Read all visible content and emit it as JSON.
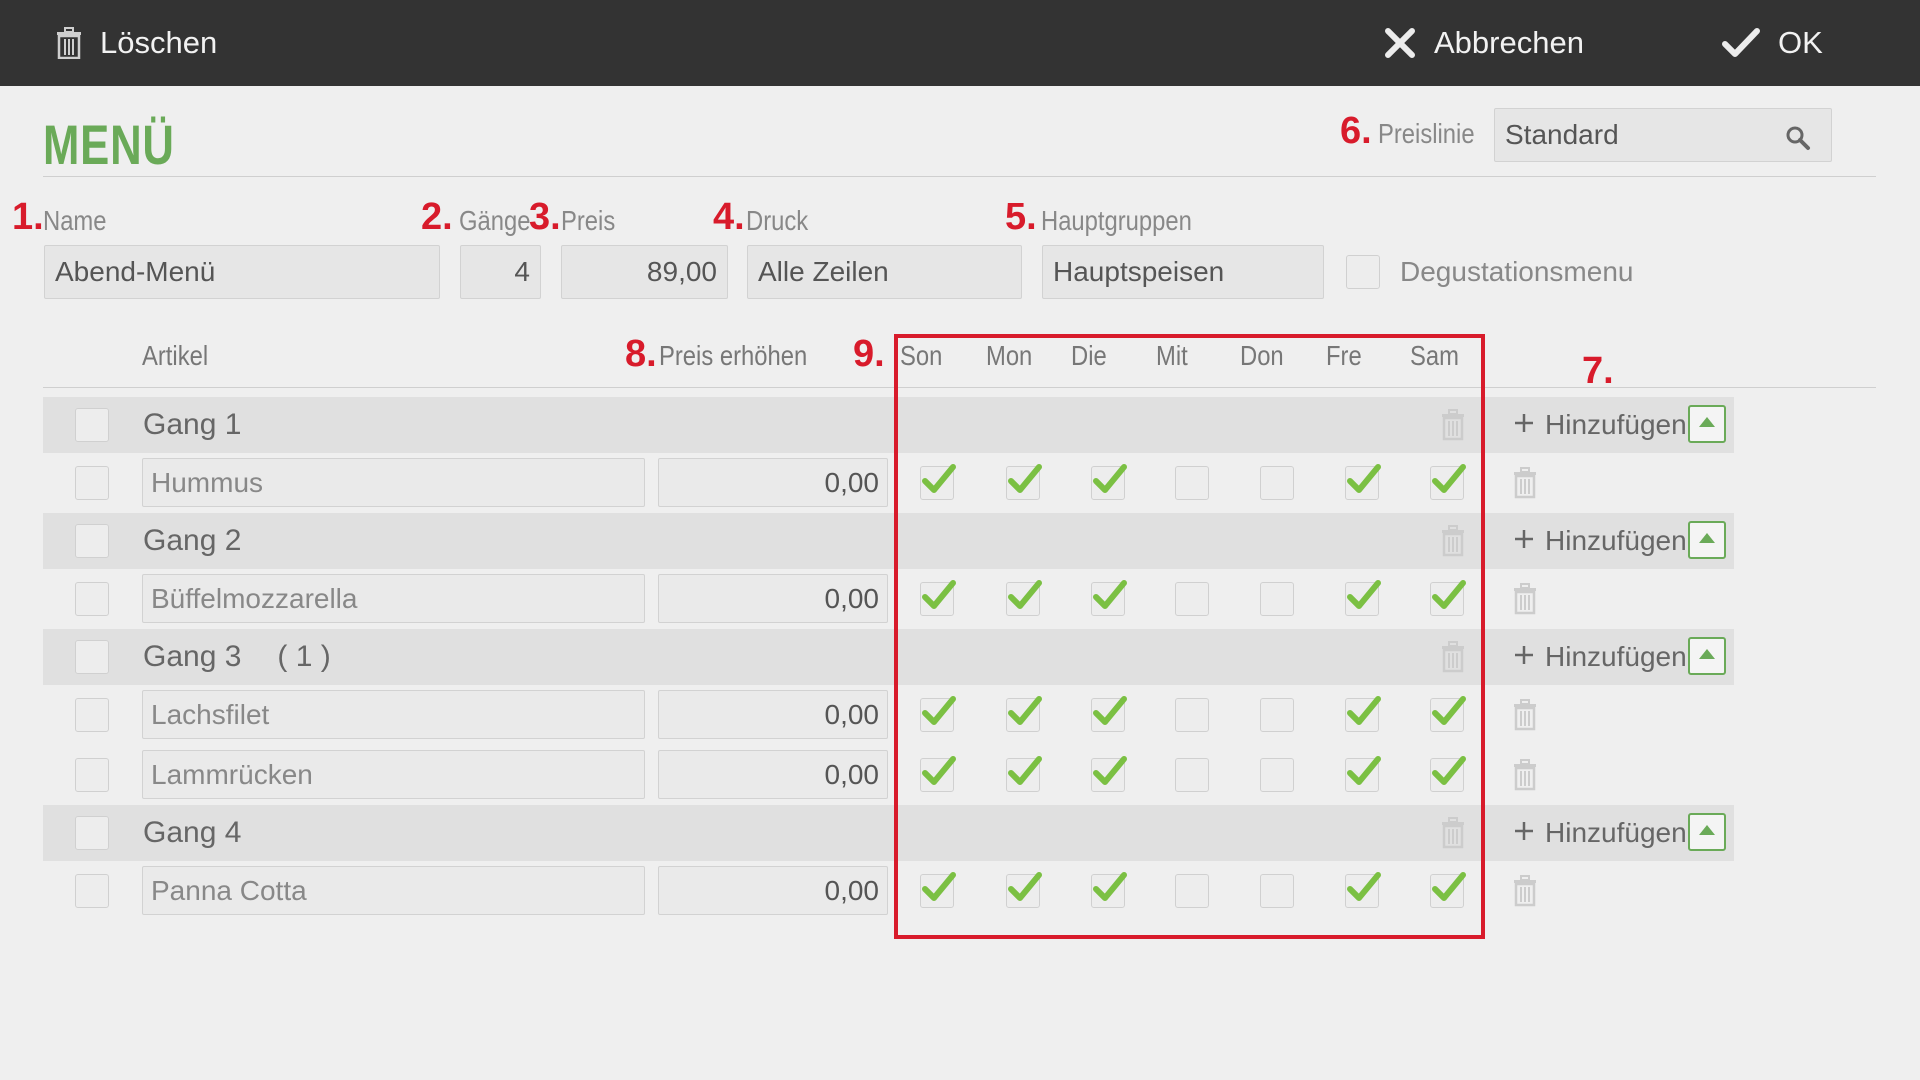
{
  "toolbar": {
    "delete_label": "Löschen",
    "cancel_label": "Abbrechen",
    "ok_label": "OK"
  },
  "page": {
    "title": "MENÜ"
  },
  "annotations": {
    "n1": "1.",
    "n2": "2.",
    "n3": "3.",
    "n4": "4.",
    "n5": "5.",
    "n6": "6.",
    "n7": "7.",
    "n8": "8.",
    "n9": "9."
  },
  "pricelist": {
    "label": "Preislinie",
    "value": "Standard"
  },
  "form": {
    "name_label": "Name",
    "name_value": "Abend-Menü",
    "courses_label": "Gänge",
    "courses_value": "4",
    "price_label": "Preis",
    "price_value": "89,00",
    "print_label": "Druck",
    "print_value": "Alle Zeilen",
    "maingroups_label": "Hauptgruppen",
    "maingroups_value": "Hauptspeisen",
    "degustation_label": "Degustationsmenu",
    "degustation_checked": false
  },
  "table": {
    "article_header": "Artikel",
    "price_increase_header": "Preis erhöhen",
    "days": [
      "Son",
      "Mon",
      "Die",
      "Mit",
      "Don",
      "Fre",
      "Sam"
    ],
    "add_label": "Hinzufügen",
    "groups": [
      {
        "label": "Gang 1",
        "count": "",
        "items": [
          {
            "name": "Hummus",
            "price": "0,00",
            "days": [
              true,
              true,
              true,
              false,
              false,
              true,
              true
            ]
          }
        ]
      },
      {
        "label": "Gang 2",
        "count": "",
        "items": [
          {
            "name": "Büffelmozzarella",
            "price": "0,00",
            "days": [
              true,
              true,
              true,
              false,
              false,
              true,
              true
            ]
          }
        ]
      },
      {
        "label": "Gang 3",
        "count": "( 1 )",
        "items": [
          {
            "name": "Lachsfilet",
            "price": "0,00",
            "days": [
              true,
              true,
              true,
              false,
              false,
              true,
              true
            ]
          },
          {
            "name": "Lammrücken",
            "price": "0,00",
            "days": [
              true,
              true,
              true,
              false,
              false,
              true,
              true
            ]
          }
        ]
      },
      {
        "label": "Gang 4",
        "count": "",
        "items": [
          {
            "name": "Panna Cotta",
            "price": "0,00",
            "days": [
              true,
              true,
              true,
              false,
              false,
              true,
              true
            ]
          }
        ]
      }
    ]
  },
  "colors": {
    "accent_green": "#6aaa58",
    "check_green": "#7bc043",
    "annotation_red": "#d81b2b",
    "topbar": "#333333"
  },
  "icons": {
    "delete": "trash-icon",
    "cancel": "close-icon",
    "ok": "checkmark-icon",
    "search": "search-icon",
    "add": "plus-icon",
    "collapse": "caret-up-icon"
  }
}
